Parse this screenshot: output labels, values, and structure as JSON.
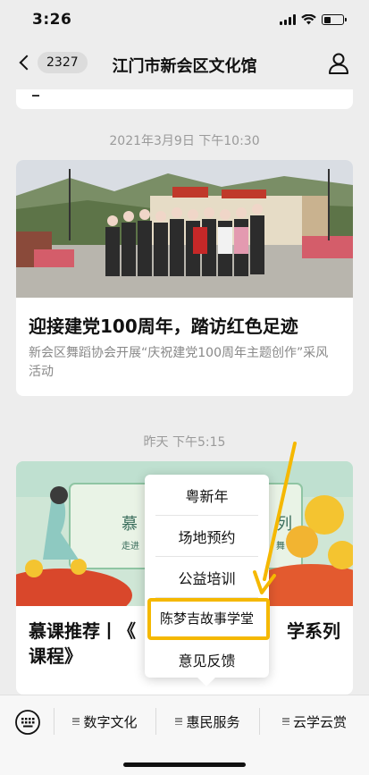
{
  "status_bar": {
    "time": "3:26"
  },
  "nav": {
    "back_count": "2327",
    "title": "江门市新会区文化馆"
  },
  "feed": [
    {
      "timestamp": "2021年3月9日 下午10:30",
      "title": "迎接建党100周年，踏访红色足迹",
      "description": "新会区舞蹈协会开展“庆祝建党100周年主题创作”采风活动"
    },
    {
      "timestamp": "昨天 下午5:15",
      "title": "慕课推荐丨《",
      "title_tail": "学系列",
      "title_line2": "课程》",
      "banner_text_left": "慕",
      "banner_text_right": "列",
      "banner_sub_left": "走进",
      "banner_sub_right": "舞"
    }
  ],
  "popup_menu": {
    "items": [
      "粤新年",
      "场地预约",
      "公益培训",
      "陈梦吉故事学堂",
      "意见反馈"
    ],
    "highlighted": "陈梦吉故事学堂"
  },
  "bottom_menu": {
    "items": [
      "数字文化",
      "惠民服务",
      "云学云赏"
    ]
  },
  "colors": {
    "highlight": "#f5b800",
    "background": "#ededed"
  }
}
